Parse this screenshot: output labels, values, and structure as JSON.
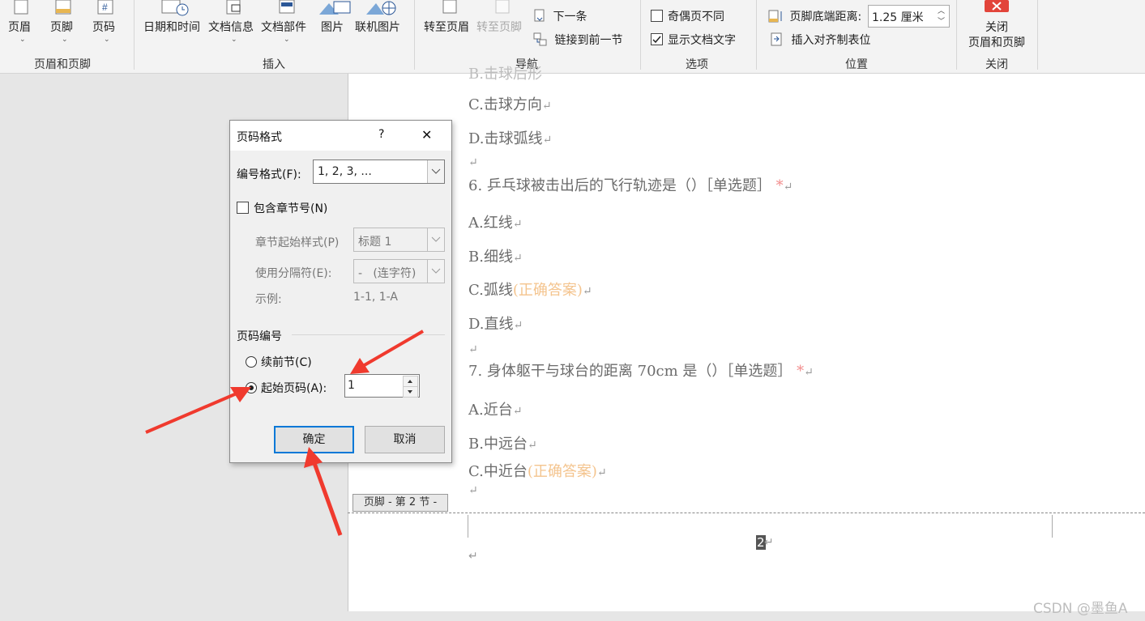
{
  "ribbon": {
    "groups": {
      "header_footer": {
        "label": "页眉和页脚",
        "items": [
          "页眉",
          "页脚",
          "页码"
        ]
      },
      "insert": {
        "label": "插入",
        "items": [
          "日期和时间",
          "文档信息",
          "文档部件",
          "图片",
          "联机图片"
        ]
      },
      "navigation": {
        "label": "导航",
        "goto_header": "转至页眉",
        "goto_footer": "转至页脚",
        "next": "下一条",
        "link_prev": "链接到前一节"
      },
      "options": {
        "label": "选项",
        "odd_even": "奇偶页不同",
        "show_doc_text": "显示文档文字"
      },
      "position": {
        "label": "位置",
        "footer_distance_label": "页脚底端距离:",
        "footer_distance_value": "1.25 厘米",
        "insert_align_tab": "插入对齐制表位"
      },
      "close": {
        "label": "关闭",
        "button_line1": "关闭",
        "button_line2": "页眉和页脚"
      }
    }
  },
  "document": {
    "lines": [
      {
        "text": "C.击球方向"
      },
      {
        "text": "D.击球弧线"
      },
      {
        "text": "6. 乒乓球被击出后的飞行轨迹是（）［单选题］",
        "star": "*"
      },
      {
        "text": "A.红线"
      },
      {
        "text": "B.细线"
      },
      {
        "text": "C.弧线",
        "answer": "(正确答案)"
      },
      {
        "text": "D.直线"
      },
      {
        "text": "7. 身体躯干与球台的距离 70cm 是（）［单选题］",
        "star": "*"
      },
      {
        "text": "A.近台"
      },
      {
        "text": "B.中远台"
      },
      {
        "text": "C.中近台",
        "answer": "(正确答案)"
      }
    ],
    "return_mark": "↵",
    "footer_tag": "页脚 - 第 2 节 -",
    "page_number": "2",
    "watermark": "CSDN @墨鱼A"
  },
  "dialog": {
    "title": "页码格式",
    "help": "?",
    "close": "✕",
    "number_format_label": "编号格式(F):",
    "number_format_value": "1, 2, 3, ...",
    "include_chapter_label": "包含章节号(N)",
    "chapter_style_label": "章节起始样式(P)",
    "chapter_style_value": "标题 1",
    "separator_label": "使用分隔符(E):",
    "separator_value": "-   (连字符)",
    "example_label": "示例:",
    "example_value": "1-1, 1-A",
    "numbering_section": "页码编号",
    "continue_label": "续前节(C)",
    "start_at_label": "起始页码(A):",
    "start_at_value": "1",
    "ok": "确定",
    "cancel": "取消"
  },
  "colors": {
    "annotation_arrow": "#f03a2e",
    "answer": "#f4c48e",
    "required_star": "#f28b8b"
  }
}
